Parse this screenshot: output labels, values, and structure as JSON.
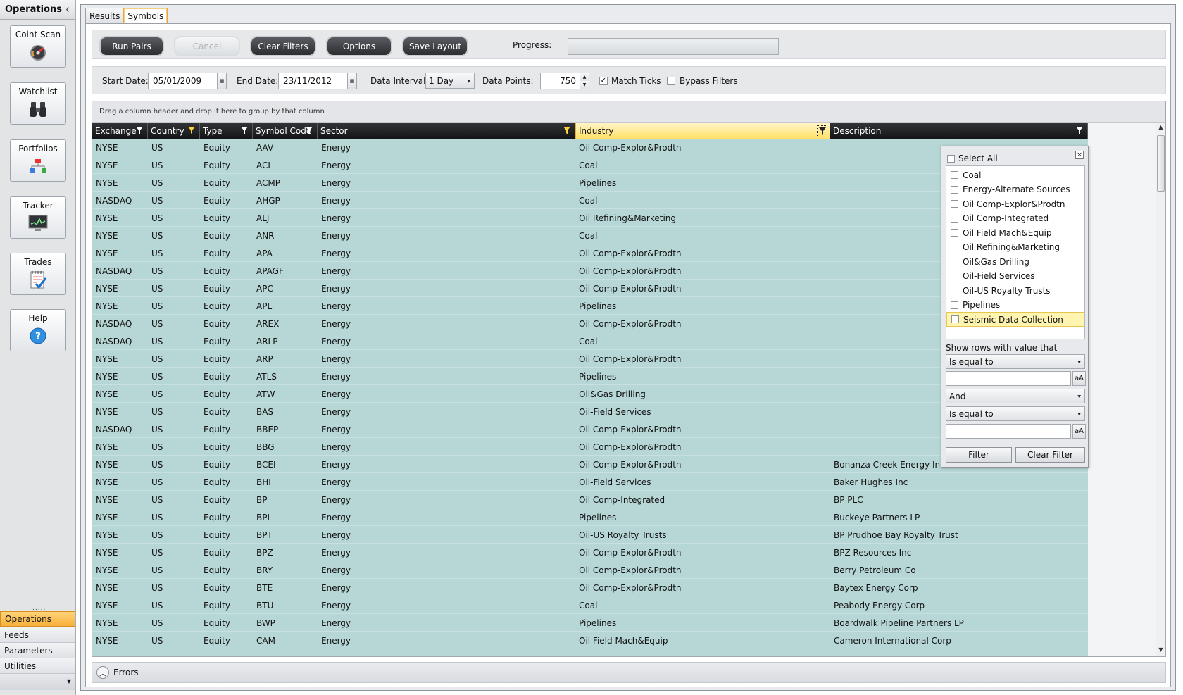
{
  "left_panel": {
    "title": "Operations",
    "tools": [
      {
        "label": "Coint Scan",
        "icon": "gauge-icon"
      },
      {
        "label": "Watchlist",
        "icon": "binoculars-icon"
      },
      {
        "label": "Portfolios",
        "icon": "hierarchy-icon"
      },
      {
        "label": "Tracker",
        "icon": "monitor-chart-icon"
      },
      {
        "label": "Trades",
        "icon": "notepad-check-icon"
      },
      {
        "label": "Help",
        "icon": "question-icon"
      }
    ],
    "nav": [
      "Operations",
      "Feeds",
      "Parameters",
      "Utilities"
    ],
    "active_nav": "Operations"
  },
  "tabs": [
    "Results",
    "Symbols"
  ],
  "active_tab": "Symbols",
  "toolbar": {
    "run_pairs": "Run Pairs",
    "cancel": "Cancel",
    "clear_filters": "Clear Filters",
    "options": "Options",
    "save_layout": "Save Layout",
    "progress_label": "Progress:",
    "progress_value": 0
  },
  "params": {
    "start_label": "Start Date:",
    "start_value": "05/01/2009",
    "end_label": "End Date:",
    "end_value": "23/11/2012",
    "interval_label": "Data Interval:",
    "interval_value": "1 Day",
    "points_label": "Data Points:",
    "points_value": "750",
    "match_ticks_label": "Match Ticks",
    "match_ticks_checked": true,
    "bypass_label": "Bypass Filters",
    "bypass_checked": false
  },
  "grid": {
    "group_hint": "Drag a column header and drop it here to group by that column",
    "columns": [
      "Exchange",
      "Country",
      "Type",
      "Symbol Code",
      "Sector",
      "Industry",
      "Description"
    ],
    "filtered_columns": [
      "Country",
      "Sector"
    ],
    "open_filter_column": "Industry",
    "rows": [
      [
        "NYSE",
        "US",
        "Equity",
        "AAV",
        "Energy",
        "Oil Comp-Explor&Prodtn",
        ""
      ],
      [
        "NYSE",
        "US",
        "Equity",
        "ACI",
        "Energy",
        "Coal",
        ""
      ],
      [
        "NYSE",
        "US",
        "Equity",
        "ACMP",
        "Energy",
        "Pipelines",
        ""
      ],
      [
        "NASDAQ",
        "US",
        "Equity",
        "AHGP",
        "Energy",
        "Coal",
        ""
      ],
      [
        "NYSE",
        "US",
        "Equity",
        "ALJ",
        "Energy",
        "Oil Refining&Marketing",
        ""
      ],
      [
        "NYSE",
        "US",
        "Equity",
        "ANR",
        "Energy",
        "Coal",
        ""
      ],
      [
        "NYSE",
        "US",
        "Equity",
        "APA",
        "Energy",
        "Oil Comp-Explor&Prodtn",
        ""
      ],
      [
        "NASDAQ",
        "US",
        "Equity",
        "APAGF",
        "Energy",
        "Oil Comp-Explor&Prodtn",
        ""
      ],
      [
        "NYSE",
        "US",
        "Equity",
        "APC",
        "Energy",
        "Oil Comp-Explor&Prodtn",
        ""
      ],
      [
        "NYSE",
        "US",
        "Equity",
        "APL",
        "Energy",
        "Pipelines",
        ""
      ],
      [
        "NASDAQ",
        "US",
        "Equity",
        "AREX",
        "Energy",
        "Oil Comp-Explor&Prodtn",
        ""
      ],
      [
        "NASDAQ",
        "US",
        "Equity",
        "ARLP",
        "Energy",
        "Coal",
        ""
      ],
      [
        "NYSE",
        "US",
        "Equity",
        "ARP",
        "Energy",
        "Oil Comp-Explor&Prodtn",
        ""
      ],
      [
        "NYSE",
        "US",
        "Equity",
        "ATLS",
        "Energy",
        "Pipelines",
        ""
      ],
      [
        "NYSE",
        "US",
        "Equity",
        "ATW",
        "Energy",
        "Oil&Gas Drilling",
        ""
      ],
      [
        "NYSE",
        "US",
        "Equity",
        "BAS",
        "Energy",
        "Oil-Field Services",
        ""
      ],
      [
        "NASDAQ",
        "US",
        "Equity",
        "BBEP",
        "Energy",
        "Oil Comp-Explor&Prodtn",
        ""
      ],
      [
        "NYSE",
        "US",
        "Equity",
        "BBG",
        "Energy",
        "Oil Comp-Explor&Prodtn",
        ""
      ],
      [
        "NYSE",
        "US",
        "Equity",
        "BCEI",
        "Energy",
        "Oil Comp-Explor&Prodtn",
        "Bonanza Creek Energy Inc"
      ],
      [
        "NYSE",
        "US",
        "Equity",
        "BHI",
        "Energy",
        "Oil-Field Services",
        "Baker Hughes Inc"
      ],
      [
        "NYSE",
        "US",
        "Equity",
        "BP",
        "Energy",
        "Oil Comp-Integrated",
        "BP PLC"
      ],
      [
        "NYSE",
        "US",
        "Equity",
        "BPL",
        "Energy",
        "Pipelines",
        "Buckeye Partners LP"
      ],
      [
        "NYSE",
        "US",
        "Equity",
        "BPT",
        "Energy",
        "Oil-US Royalty Trusts",
        "BP Prudhoe Bay Royalty Trust"
      ],
      [
        "NYSE",
        "US",
        "Equity",
        "BPZ",
        "Energy",
        "Oil Comp-Explor&Prodtn",
        "BPZ Resources Inc"
      ],
      [
        "NYSE",
        "US",
        "Equity",
        "BRY",
        "Energy",
        "Oil Comp-Explor&Prodtn",
        "Berry Petroleum Co"
      ],
      [
        "NYSE",
        "US",
        "Equity",
        "BTE",
        "Energy",
        "Oil Comp-Explor&Prodtn",
        "Baytex Energy Corp"
      ],
      [
        "NYSE",
        "US",
        "Equity",
        "BTU",
        "Energy",
        "Coal",
        "Peabody Energy Corp"
      ],
      [
        "NYSE",
        "US",
        "Equity",
        "BWP",
        "Energy",
        "Pipelines",
        "Boardwalk Pipeline Partners LP"
      ],
      [
        "NYSE",
        "US",
        "Equity",
        "CAM",
        "Energy",
        "Oil Field Mach&Equip",
        "Cameron International Corp"
      ]
    ]
  },
  "filter_popup": {
    "select_all": "Select All",
    "items": [
      "Coal",
      "Energy-Alternate Sources",
      "Oil Comp-Explor&Prodtn",
      "Oil Comp-Integrated",
      "Oil Field Mach&Equip",
      "Oil Refining&Marketing",
      "Oil&Gas Drilling",
      "Oil-Field Services",
      "Oil-US Royalty Trusts",
      "Pipelines",
      "Seismic Data Collection"
    ],
    "highlighted": "Seismic Data Collection",
    "show_rows_label": "Show rows with value that",
    "op1": "Is equal to",
    "logic": "And",
    "op2": "Is equal to",
    "case_label": "aA",
    "filter_btn": "Filter",
    "clear_btn": "Clear Filter"
  },
  "errors": {
    "label": "Errors"
  }
}
